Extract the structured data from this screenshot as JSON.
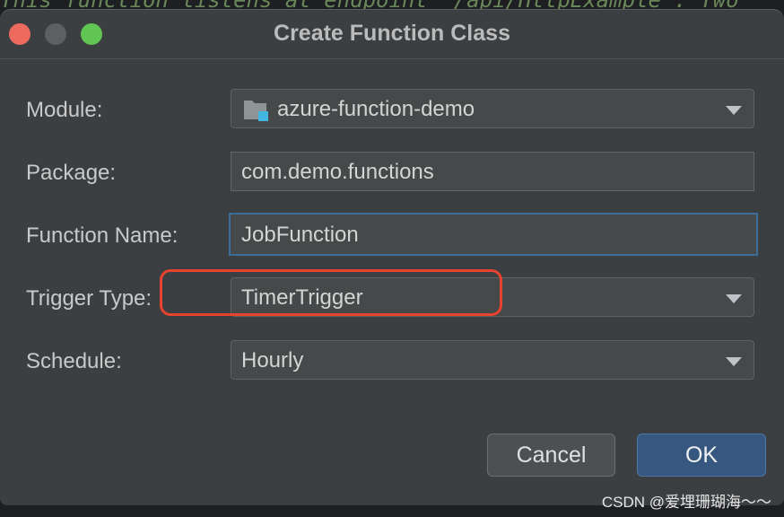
{
  "background_code": "This function listens at endpoint \"/api/HttpExample\". Two",
  "dialog": {
    "title": "Create Function Class",
    "fields": {
      "module": {
        "label": "Module:",
        "value": "azure-function-demo",
        "icon": "folder-module-icon"
      },
      "package": {
        "label": "Package:",
        "value": "com.demo.functions"
      },
      "function_name": {
        "label": "Function Name:",
        "value": "JobFunction"
      },
      "trigger_type": {
        "label": "Trigger Type:",
        "value": "TimerTrigger"
      },
      "schedule": {
        "label": "Schedule:",
        "value": "Hourly"
      }
    },
    "buttons": {
      "cancel": "Cancel",
      "ok": "OK"
    }
  },
  "annotation": {
    "color": "#e8432f"
  },
  "watermark": "CSDN @爱埋珊瑚海～～",
  "colors": {
    "dialog_bg": "#3c3f41",
    "accent": "#365880",
    "focus": "#3c6e99"
  }
}
